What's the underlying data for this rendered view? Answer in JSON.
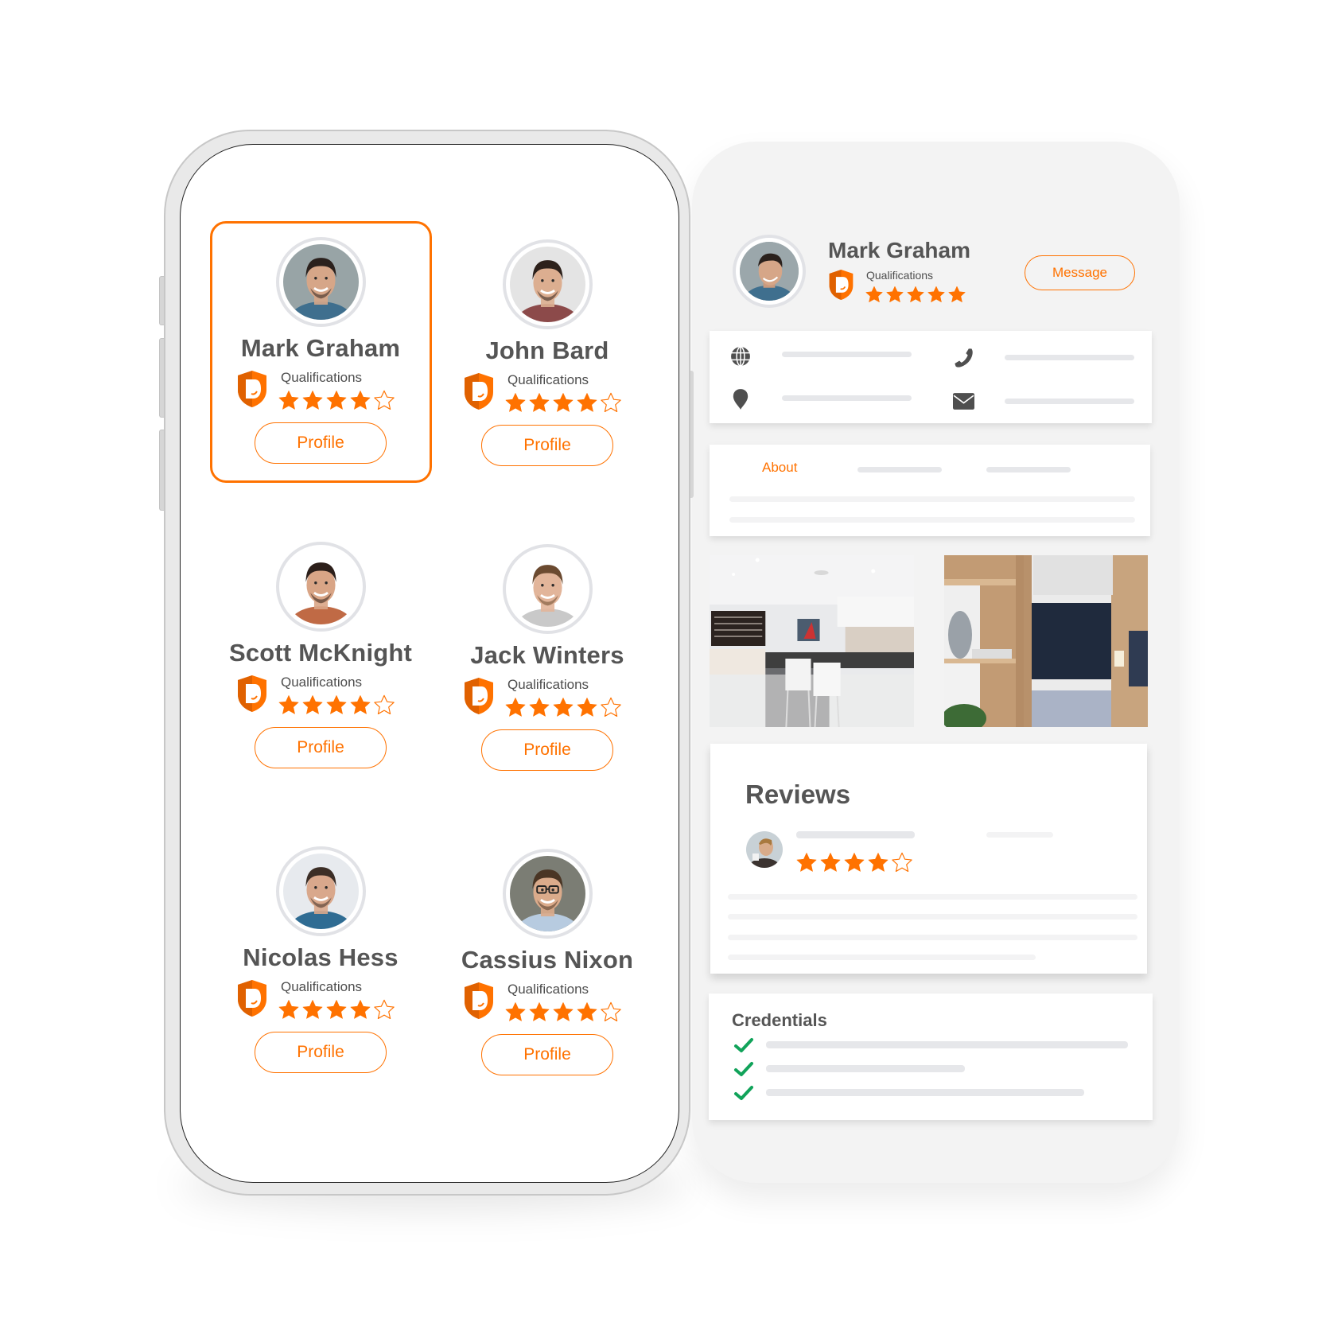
{
  "colors": {
    "accent": "#ff7200",
    "text_dark": "#555555",
    "check_green": "#11a35a",
    "skeleton": "#e6e7ea",
    "panel_bg": "#f3f3f3"
  },
  "phone_list": {
    "selected_index": 0,
    "qualification_label": "Qualifications",
    "profile_button_label": "Profile",
    "people": [
      {
        "name": "Mark Graham",
        "rating": 4,
        "max_rating": 5,
        "avatar": "avatar-mark-graham"
      },
      {
        "name": "John Bard",
        "rating": 4,
        "max_rating": 5,
        "avatar": "avatar-john-bard"
      },
      {
        "name": "Scott McKnight",
        "rating": 4,
        "max_rating": 5,
        "avatar": "avatar-scott-mcknight"
      },
      {
        "name": "Jack Winters",
        "rating": 4,
        "max_rating": 5,
        "avatar": "avatar-jack-winters"
      },
      {
        "name": "Nicolas Hess",
        "rating": 4,
        "max_rating": 5,
        "avatar": "avatar-nicolas-hess"
      },
      {
        "name": "Cassius Nixon",
        "rating": 4,
        "max_rating": 5,
        "avatar": "avatar-cassius-nixon"
      }
    ]
  },
  "profile_detail": {
    "name": "Mark Graham",
    "qualification_label": "Qualifications",
    "rating": 5,
    "max_rating": 5,
    "message_button": "Message",
    "contact_icons": [
      "globe-icon",
      "phone-icon",
      "location-pin-icon",
      "envelope-icon"
    ],
    "tabs": [
      {
        "label": "About",
        "active": true
      }
    ],
    "photos": [
      "kitchen-photo",
      "wardrobe-photo"
    ],
    "reviews": {
      "title": "Reviews",
      "items": [
        {
          "rating": 4,
          "max_rating": 5
        }
      ]
    },
    "credentials": {
      "title": "Credentials",
      "count": 3
    }
  }
}
